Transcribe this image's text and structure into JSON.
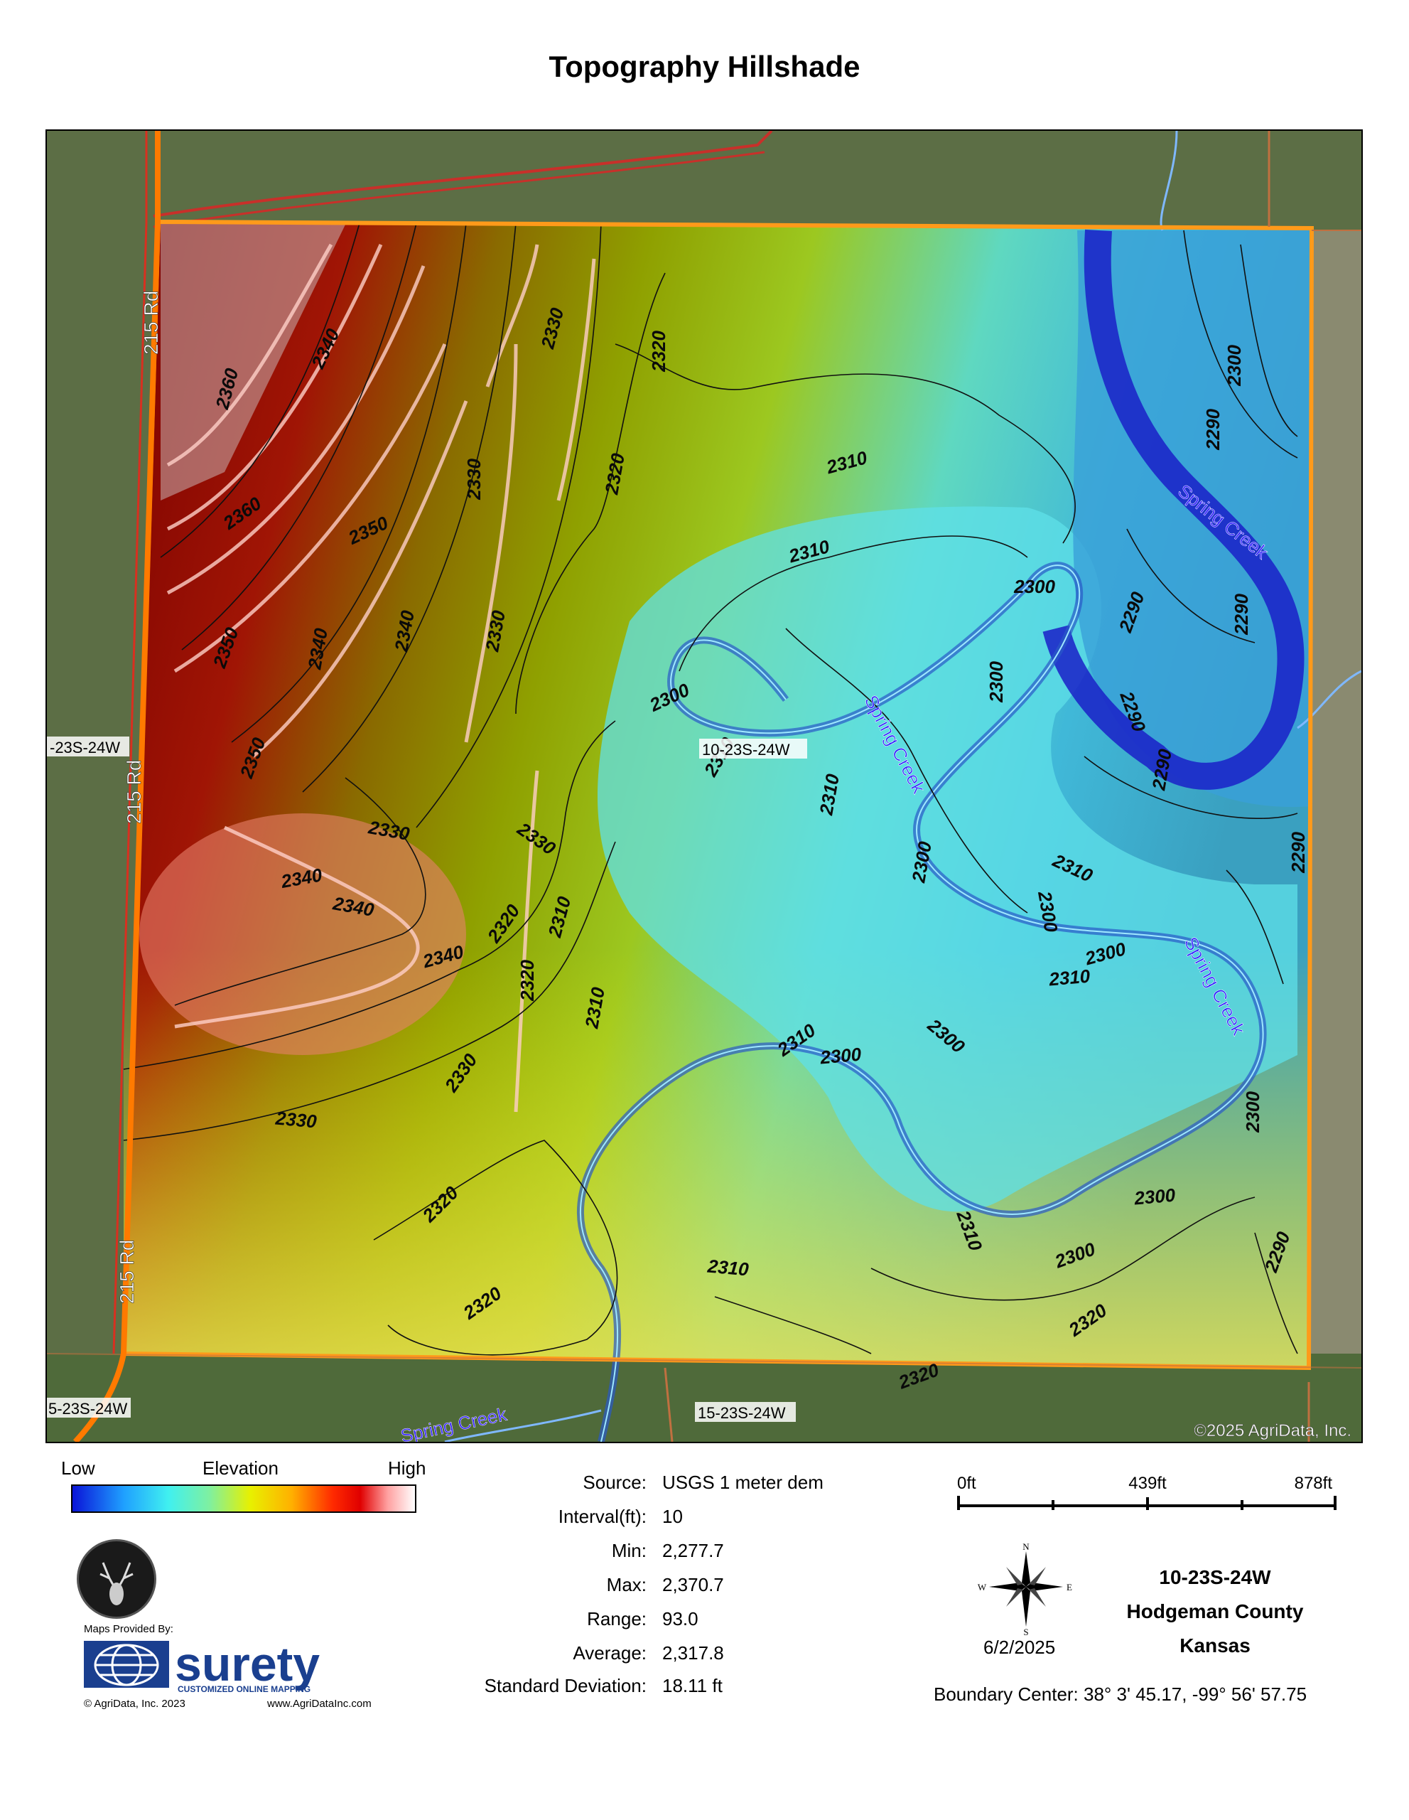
{
  "title": "Topography Hillshade",
  "map": {
    "copyright": "©2025 AgriData, Inc.",
    "road_labels": [
      "215 Rd",
      "215 Rd",
      "215 Rd"
    ],
    "section_labels": {
      "center": "10-23S-24W",
      "west": "-23S-24W",
      "southwest": "5-23S-24W",
      "south": "15-23S-24W"
    },
    "creek_labels": [
      "Spring Creek",
      "Spring Creek",
      "Spring Creek",
      "Spring Creek"
    ],
    "contour_labels": [
      "2360",
      "2360",
      "2350",
      "2350",
      "2350",
      "2340",
      "2340",
      "2340",
      "2340",
      "2340",
      "2340",
      "2330",
      "2330",
      "2330",
      "2330",
      "2330",
      "2330",
      "2330",
      "2320",
      "2320",
      "2320",
      "2320",
      "2320",
      "2320",
      "2320",
      "2320",
      "2310",
      "2310",
      "2310",
      "2310",
      "2310",
      "2310",
      "2310",
      "2310",
      "2310",
      "2310",
      "2310",
      "2300",
      "2300",
      "2300",
      "2300",
      "2300",
      "2300",
      "2300",
      "2300",
      "2300",
      "2300",
      "2300",
      "2300",
      "2290",
      "2290",
      "2290",
      "2290",
      "2290",
      "2290",
      "2290"
    ],
    "colors": {
      "boundary": "#ff9a1a",
      "creek_label": "#3322ff",
      "high": "#8b0000",
      "low": "#1010c0"
    }
  },
  "legend": {
    "low_label": "Low",
    "elevation_label": "Elevation",
    "high_label": "High"
  },
  "stats": [
    {
      "label": "Source:",
      "value": "USGS 1 meter dem"
    },
    {
      "label": "Interval(ft):",
      "value": "10"
    },
    {
      "label": "Min:",
      "value": "2,277.7"
    },
    {
      "label": "Max:",
      "value": "2,370.7"
    },
    {
      "label": "Range:",
      "value": "93.0"
    },
    {
      "label": "Average:",
      "value": "2,317.8"
    },
    {
      "label": "Standard Deviation:",
      "value": "18.11 ft"
    }
  ],
  "scale": {
    "labels": [
      "0ft",
      "439ft",
      "878ft"
    ]
  },
  "compass": {
    "n": "N",
    "s": "S",
    "e": "E",
    "w": "W"
  },
  "date": "6/2/2025",
  "tract": {
    "section": "10-23S-24W",
    "county": "Hodgeman County",
    "state": "Kansas"
  },
  "boundary_center": "Boundary Center: 38° 3' 45.17,  -99° 56' 57.75",
  "branding": {
    "maps_provided_by": "Maps Provided By:",
    "logo_text": "surety",
    "logo_tagline": "CUSTOMIZED ONLINE MAPPING",
    "copyright": "© AgriData, Inc. 2023",
    "url": "www.AgriDataInc.com"
  }
}
